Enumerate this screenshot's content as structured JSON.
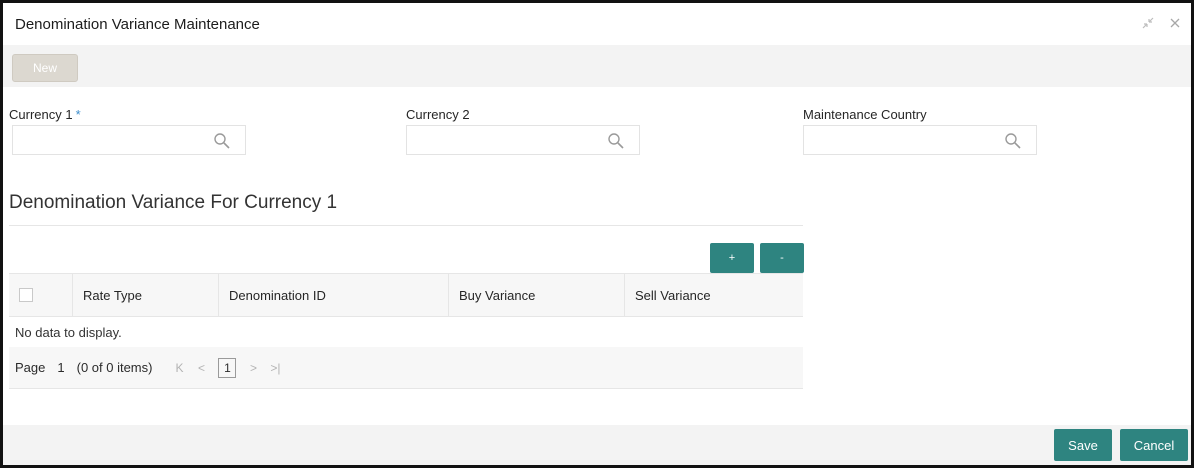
{
  "window": {
    "title": "Denomination Variance Maintenance",
    "icons": [
      "minimize-icon",
      "close-icon"
    ]
  },
  "toolbar": {
    "new_label": "New"
  },
  "fields": {
    "currency1": {
      "label": "Currency 1",
      "required": "*",
      "value": "",
      "icon": "search-icon"
    },
    "currency2": {
      "label": "Currency 2",
      "value": "",
      "icon": "search-icon"
    },
    "maintenance_country": {
      "label": "Maintenance Country",
      "value": "",
      "icon": "search-icon"
    }
  },
  "section": {
    "title": "Denomination Variance For Currency 1"
  },
  "grid_actions": {
    "add_label": "+",
    "remove_label": "-"
  },
  "grid": {
    "columns": [
      "Rate Type",
      "Denomination ID",
      "Buy Variance",
      "Sell Variance"
    ],
    "rows": [],
    "empty_text": "No data to display."
  },
  "pager": {
    "page_label": "Page",
    "page_number": "1",
    "items_text": "(0 of 0 items)",
    "current_page": "1"
  },
  "footer": {
    "save_label": "Save",
    "cancel_label": "Cancel"
  },
  "colors": {
    "accent": "#2e8480",
    "required": "#3c8dcc",
    "toolbar_bg": "#f3f3f3"
  }
}
